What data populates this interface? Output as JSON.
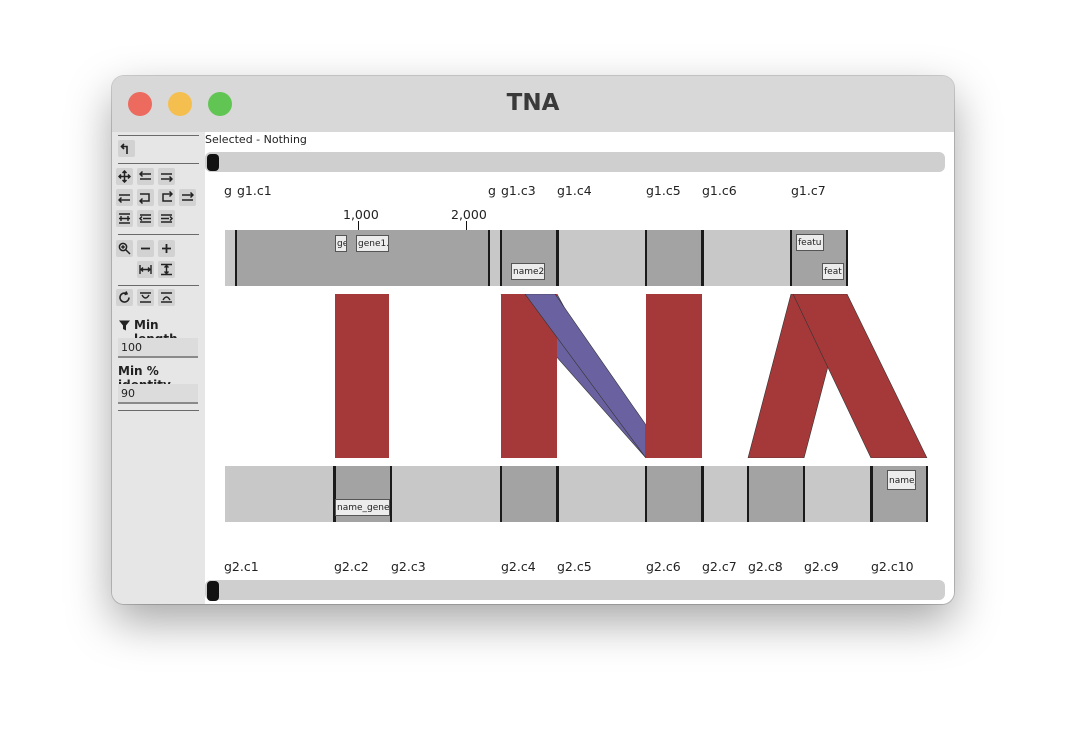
{
  "window": {
    "title": "TNA"
  },
  "sidebar": {
    "min_length_label": "Min length",
    "min_length_value": "100",
    "min_identity_label": "Min % identity",
    "min_identity_value": "90"
  },
  "main": {
    "selected_text": "Selected - Nothing",
    "top_labels": [
      "g",
      "g1.c1",
      "g",
      "g1.c3",
      "g1.c4",
      "g1.c5",
      "g1.c6",
      "g1.c7"
    ],
    "ruler": [
      "1,000",
      "2,000"
    ],
    "top_features": [
      "gen",
      "gene1.",
      "name2",
      "featu",
      "feat"
    ],
    "bottom_features": [
      "name_gene",
      "name_"
    ],
    "bottom_labels": [
      "g2.c1",
      "g2.c2",
      "g2.c3",
      "g2.c4",
      "g2.c5",
      "g2.c6",
      "g2.c7",
      "g2.c8",
      "g2.c9",
      "g2.c10"
    ]
  },
  "colors": {
    "match_forward": "#a5393a",
    "match_reverse": "#6a62a0",
    "contig_dark": "#a3a3a3",
    "contig_light": "#c8c8c8"
  }
}
